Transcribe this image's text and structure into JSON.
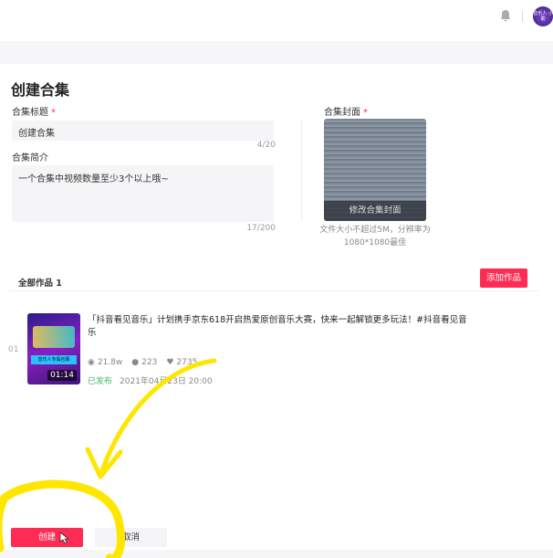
{
  "header": {
    "avatar_text": "音乐人\n小助"
  },
  "page": {
    "title": "创建合集"
  },
  "form": {
    "title_label": "合集标题",
    "required_mark": "*",
    "title_value": "创建合集",
    "title_count": "4/20",
    "intro_label": "合集简介",
    "intro_value": "一个合集中视频数量至少3个以上哦~",
    "intro_count": "17/200",
    "cover_label": "合集封面",
    "cover_button": "修改合集封面",
    "cover_hint": "文件大小不超过5M，分辨率为1080*1080最佳"
  },
  "works": {
    "header": "全部作品 1",
    "add_button": "添加作品",
    "items": [
      {
        "index": "01",
        "title": "「抖音看见音乐」计划携手京东618开启热爱原创音乐大赛，快来一起解锁更多玩法！#抖音看见音乐",
        "duration": "01:14",
        "views": "21.8w",
        "comments": "223",
        "likes": "2735",
        "status": "已发布",
        "date": "2021年04月23日 20:00",
        "thumb_text": "音乐人专属召募"
      }
    ]
  },
  "footer": {
    "create_button": "创建",
    "cancel_button": "取消"
  },
  "colors": {
    "accent": "#fe2c55",
    "published": "#3fb96b",
    "annotation": "#ffe600"
  }
}
